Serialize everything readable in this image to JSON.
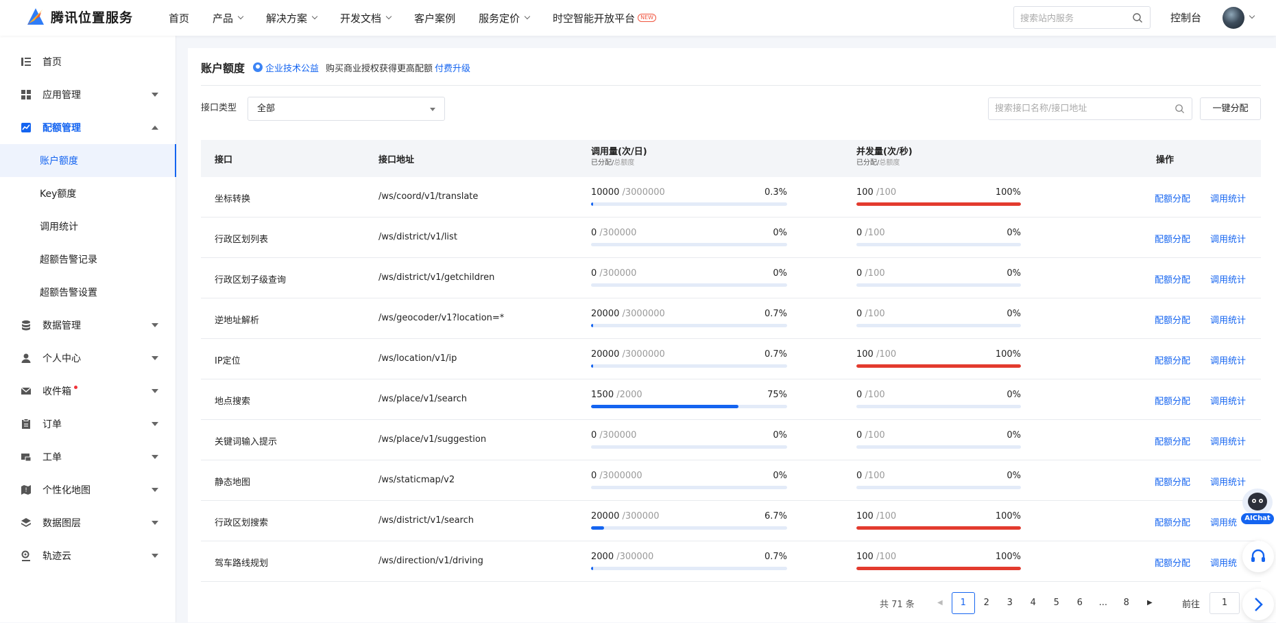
{
  "topbar": {
    "logo_text": "腾讯位置服务",
    "nav": [
      {
        "label": "首页",
        "caret": false
      },
      {
        "label": "产品",
        "caret": true
      },
      {
        "label": "解决方案",
        "caret": true
      },
      {
        "label": "开发文档",
        "caret": true
      },
      {
        "label": "客户案例",
        "caret": false
      },
      {
        "label": "服务定价",
        "caret": true
      },
      {
        "label": "时空智能开放平台",
        "caret": false,
        "badge": "NEW"
      }
    ],
    "search_placeholder": "搜索站内服务",
    "console_label": "控制台"
  },
  "sidebar": {
    "items": [
      {
        "label": "首页",
        "icon": "list-icon"
      },
      {
        "label": "应用管理",
        "icon": "grid-icon"
      },
      {
        "label": "配额管理",
        "icon": "chart-icon"
      },
      {
        "label": "账户额度"
      },
      {
        "label": "Key额度"
      },
      {
        "label": "调用统计"
      },
      {
        "label": "超额告警记录"
      },
      {
        "label": "超额告警设置"
      },
      {
        "label": "数据管理",
        "icon": "database-icon"
      },
      {
        "label": "个人中心",
        "icon": "user-icon"
      },
      {
        "label": "收件箱",
        "icon": "mail-icon"
      },
      {
        "label": "订单",
        "icon": "clipboard-icon"
      },
      {
        "label": "工单",
        "icon": "ticket-icon"
      },
      {
        "label": "个性化地图",
        "icon": "custom-map-icon"
      },
      {
        "label": "数据图层",
        "icon": "layers-icon"
      },
      {
        "label": "轨迹云",
        "icon": "track-icon"
      }
    ]
  },
  "main": {
    "title": "账户额度",
    "tag": "企业技术公益",
    "promo_text": "购买商业授权获得更高配额",
    "upgrade_link": "付费升级",
    "filter_label": "接口类型",
    "filter_value": "全部",
    "search_placeholder": "搜索接口名称/接口地址",
    "assign_all_label": "一键分配",
    "columns": {
      "api": "接口",
      "path": "接口地址",
      "usage": "调用量(次/日)",
      "usage_sub_a": "已分配/",
      "usage_sub_b": "总额度",
      "concurrency": "并发量(次/秒)",
      "conc_sub_a": "已分配/",
      "conc_sub_b": "总额度",
      "ops": "操作"
    },
    "rows": [
      {
        "name": "坐标转换",
        "path": "/ws/coord/v1/translate",
        "used": "10000",
        "total": "/3000000",
        "pct": "0.3%",
        "frac": 0.003,
        "c_used": "100",
        "c_total": "/100",
        "c_pct": "100%",
        "c_frac": 1.0,
        "op1": "配额分配",
        "op2": "调用统计"
      },
      {
        "name": "行政区划列表",
        "path": "/ws/district/v1/list",
        "used": "0",
        "total": "/300000",
        "pct": "0%",
        "frac": 0,
        "c_used": "0",
        "c_total": "/100",
        "c_pct": "0%",
        "c_frac": 0,
        "op1": "配额分配",
        "op2": "调用统计"
      },
      {
        "name": "行政区划子级查询",
        "path": "/ws/district/v1/getchildren",
        "used": "0",
        "total": "/300000",
        "pct": "0%",
        "frac": 0,
        "c_used": "0",
        "c_total": "/100",
        "c_pct": "0%",
        "c_frac": 0,
        "op1": "配额分配",
        "op2": "调用统计"
      },
      {
        "name": "逆地址解析",
        "path": "/ws/geocoder/v1?location=*",
        "used": "20000",
        "total": "/3000000",
        "pct": "0.7%",
        "frac": 0.007,
        "c_used": "0",
        "c_total": "/100",
        "c_pct": "0%",
        "c_frac": 0,
        "op1": "配额分配",
        "op2": "调用统计"
      },
      {
        "name": "IP定位",
        "path": "/ws/location/v1/ip",
        "used": "20000",
        "total": "/3000000",
        "pct": "0.7%",
        "frac": 0.007,
        "c_used": "100",
        "c_total": "/100",
        "c_pct": "100%",
        "c_frac": 1.0,
        "op1": "配额分配",
        "op2": "调用统计"
      },
      {
        "name": "地点搜索",
        "path": "/ws/place/v1/search",
        "used": "1500",
        "total": "/2000",
        "pct": "75%",
        "frac": 0.75,
        "c_used": "0",
        "c_total": "/100",
        "c_pct": "0%",
        "c_frac": 0,
        "op1": "配额分配",
        "op2": "调用统计"
      },
      {
        "name": "关键词输入提示",
        "path": "/ws/place/v1/suggestion",
        "used": "0",
        "total": "/300000",
        "pct": "0%",
        "frac": 0,
        "c_used": "0",
        "c_total": "/100",
        "c_pct": "0%",
        "c_frac": 0,
        "op1": "配额分配",
        "op2": "调用统计"
      },
      {
        "name": "静态地图",
        "path": "/ws/staticmap/v2",
        "used": "0",
        "total": "/3000000",
        "pct": "0%",
        "frac": 0,
        "c_used": "0",
        "c_total": "/100",
        "c_pct": "0%",
        "c_frac": 0,
        "op1": "配额分配",
        "op2": "调用统计"
      },
      {
        "name": "行政区划搜索",
        "path": "/ws/district/v1/search",
        "used": "20000",
        "total": "/300000",
        "pct": "6.7%",
        "frac": 0.067,
        "c_used": "100",
        "c_total": "/100",
        "c_pct": "100%",
        "c_frac": 1.0,
        "op1": "配额分配",
        "op2": "调用统"
      },
      {
        "name": "驾车路线规划",
        "path": "/ws/direction/v1/driving",
        "used": "2000",
        "total": "/300000",
        "pct": "0.7%",
        "frac": 0.007,
        "c_used": "100",
        "c_total": "/100",
        "c_pct": "100%",
        "c_frac": 1.0,
        "op1": "配额分配",
        "op2": "调用统"
      }
    ],
    "pagination": {
      "total": "共 71 条",
      "pages": [
        "1",
        "2",
        "3",
        "4",
        "5",
        "6",
        "...",
        "8"
      ],
      "current": "1",
      "goto_label": "前往",
      "goto_value": "1"
    }
  },
  "floating": {
    "ai_label": "AIChat"
  },
  "colors": {
    "accent": "#1464f0",
    "danger": "#e33b2e",
    "track": "#e3ebf8"
  }
}
